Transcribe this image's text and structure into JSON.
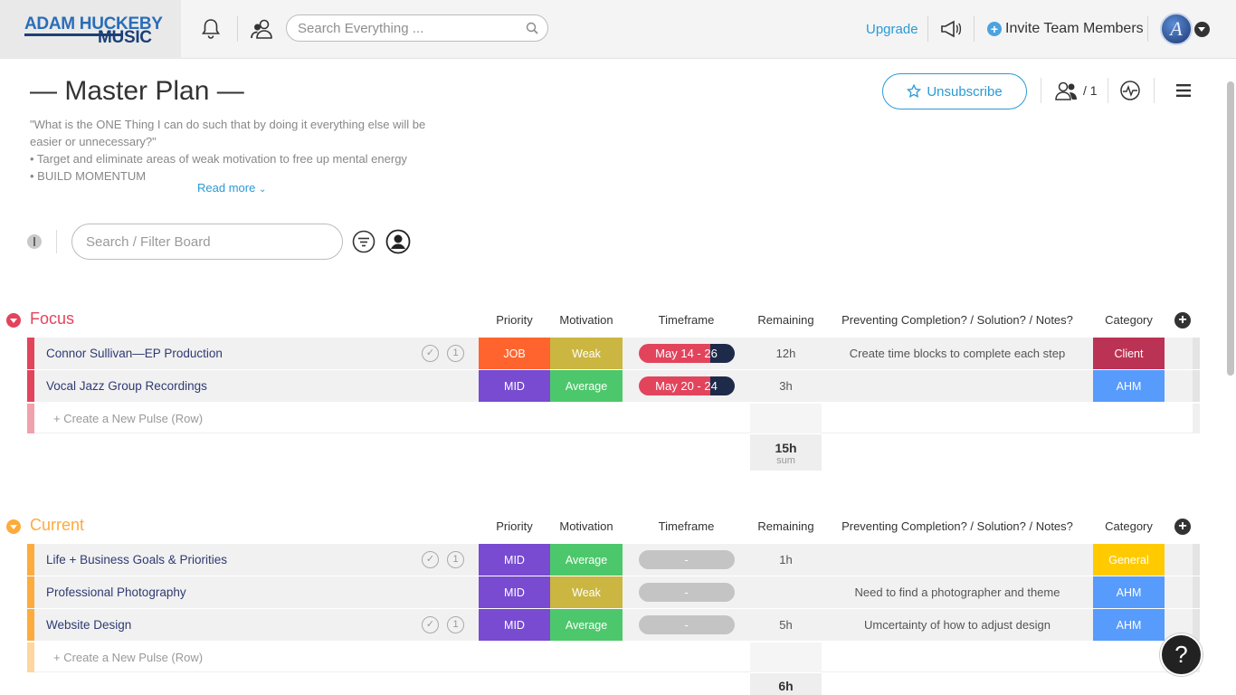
{
  "topbar": {
    "logo_line1": "ADAM HUCKEBY",
    "logo_line2": "MUSIC",
    "search_placeholder": "Search Everything ...",
    "upgrade": "Upgrade",
    "invite": "Invite Team Members",
    "avatar_letter": "A"
  },
  "board": {
    "title": "— Master Plan —",
    "desc_line1": "\"What is the ONE Thing I can do such that by doing it everything else will be easier or unnecessary?\"",
    "desc_line2": "• Target and eliminate areas of weak motivation to free up mental energy",
    "desc_line3": "• BUILD MOMENTUM",
    "read_more": "Read more",
    "unsubscribe": "Unsubscribe",
    "members_count": "/ 1",
    "filter_placeholder": "Search / Filter Board"
  },
  "columns": {
    "priority": "Priority",
    "motivation": "Motivation",
    "timeframe": "Timeframe",
    "remaining": "Remaining",
    "notes": "Preventing Completion? / Solution? / Notes?",
    "category": "Category"
  },
  "colors": {
    "focus": "#e2445c",
    "current": "#fdab3d",
    "job": "#ff642e",
    "mid": "#784bd1",
    "weak": "#cab641",
    "average": "#4dc76b",
    "client": "#bb3354",
    "ahm": "#579bfc",
    "general": "#ffcb00"
  },
  "groups": {
    "focus": {
      "title": "Focus",
      "rows": [
        {
          "name": "Connor Sullivan—EP Production",
          "updates": "1",
          "priority": "JOB",
          "motivation": "Weak",
          "timeframe": "May 14 - 26",
          "progress": 0.75,
          "remaining": "12h",
          "notes": "Create time blocks to complete each step",
          "category": "Client"
        },
        {
          "name": "Vocal Jazz Group Recordings",
          "updates": "",
          "priority": "MID",
          "motivation": "Average",
          "timeframe": "May 20 - 24",
          "progress": 0.75,
          "remaining": "3h",
          "notes": "",
          "category": "AHM"
        }
      ],
      "create": "+ Create a New Pulse (Row)",
      "sum_value": "15h",
      "sum_label": "sum"
    },
    "current": {
      "title": "Current",
      "rows": [
        {
          "name": "Life + Business Goals & Priorities",
          "updates": "1",
          "priority": "MID",
          "motivation": "Average",
          "timeframe": "-",
          "remaining": "1h",
          "notes": "",
          "category": "General"
        },
        {
          "name": "Professional Photography",
          "updates": "",
          "priority": "MID",
          "motivation": "Weak",
          "timeframe": "-",
          "remaining": "",
          "notes": "Need to find a photographer and theme",
          "category": "AHM"
        },
        {
          "name": "Website Design",
          "updates": "1",
          "priority": "MID",
          "motivation": "Average",
          "timeframe": "-",
          "remaining": "5h",
          "notes": "Umcertainty of how to adjust design",
          "category": "AHM"
        }
      ],
      "create": "+ Create a New Pulse (Row)",
      "sum_value": "6h"
    }
  },
  "help": "?"
}
